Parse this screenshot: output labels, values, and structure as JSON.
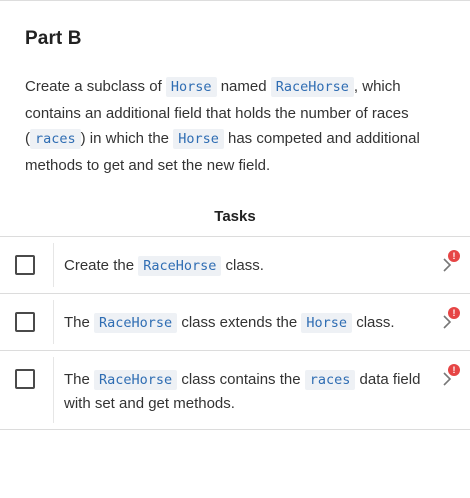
{
  "part_title": "Part B",
  "description": {
    "t1": "Create a subclass of ",
    "c1": "Horse",
    "t2": " named ",
    "c2": "RaceHorse",
    "t3": ", which contains an additional field that holds the number of races (",
    "c3": "races",
    "t4": ") in which the ",
    "c4": "Horse",
    "t5": " has competed and additional methods to get and set the new field."
  },
  "tasks_heading": "Tasks",
  "tasks": [
    {
      "t1": "Create the ",
      "c1": "RaceHorse",
      "t2": " class.",
      "t3": "",
      "c2": "",
      "t4": "",
      "badge": "!"
    },
    {
      "t1": "The ",
      "c1": "RaceHorse",
      "t2": " class extends the ",
      "c2": "Horse",
      "t3": " class.",
      "t4": "",
      "badge": "!"
    },
    {
      "t1": "The ",
      "c1": "RaceHorse",
      "t2": " class contains the ",
      "c2": "races",
      "t3": " data field with set and get methods.",
      "t4": "",
      "badge": "!"
    }
  ],
  "colors": {
    "code_text": "#2f6db3",
    "code_bg": "#eef1f5",
    "badge": "#e64545"
  }
}
